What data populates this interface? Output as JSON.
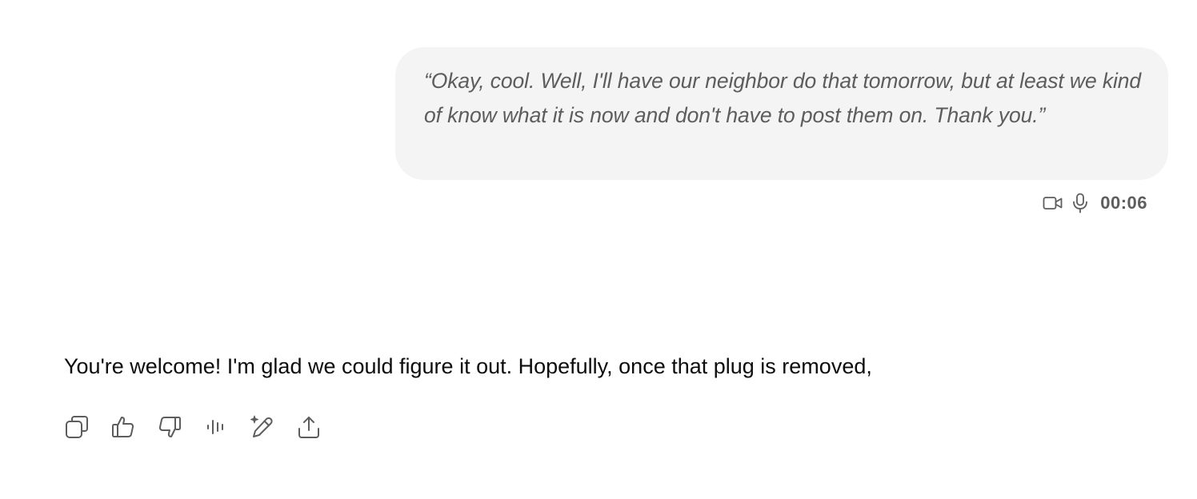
{
  "conversation": {
    "user_message": {
      "text": "“Okay, cool. Well, I'll have our neighbor do that tomorrow, but at least we kind of know what it is now and don't have to post them on. Thank you.”",
      "duration": "00:06",
      "icons": [
        "video-camera-icon",
        "microphone-icon"
      ]
    },
    "assistant_message": {
      "text": "You're welcome! I'm glad we could figure it out. Hopefully, once that plug is removed,"
    },
    "actions": [
      {
        "name": "copy-button",
        "icon": "copy-icon"
      },
      {
        "name": "thumbs-up-button",
        "icon": "thumbs-up-icon"
      },
      {
        "name": "thumbs-down-button",
        "icon": "thumbs-down-icon"
      },
      {
        "name": "read-aloud-button",
        "icon": "audio-waveform-icon"
      },
      {
        "name": "edit-in-canvas-button",
        "icon": "sparkle-pencil-icon"
      },
      {
        "name": "share-button",
        "icon": "share-upload-icon"
      }
    ]
  },
  "colors": {
    "bubble_background": "#f4f4f4",
    "muted_text": "#5d5d5d",
    "primary_text": "#0d0d0d"
  }
}
